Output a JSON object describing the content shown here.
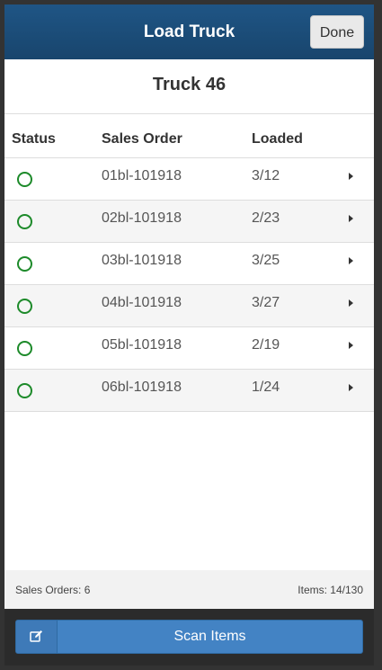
{
  "header": {
    "title": "Load Truck",
    "done_label": "Done"
  },
  "truck": {
    "title": "Truck 46"
  },
  "table": {
    "columns": [
      "Status",
      "Sales Order",
      "Loaded"
    ],
    "rows": [
      {
        "status": "incomplete",
        "order": "01bl-101918",
        "loaded": "3/12"
      },
      {
        "status": "incomplete",
        "order": "02bl-101918",
        "loaded": "2/23"
      },
      {
        "status": "incomplete",
        "order": "03bl-101918",
        "loaded": "3/25"
      },
      {
        "status": "incomplete",
        "order": "04bl-101918",
        "loaded": "3/27"
      },
      {
        "status": "incomplete",
        "order": "05bl-101918",
        "loaded": "2/19"
      },
      {
        "status": "incomplete",
        "order": "06bl-101918",
        "loaded": "1/24"
      }
    ]
  },
  "summary": {
    "sales_orders": "Sales Orders: 6",
    "items": "Items: 14/130"
  },
  "footer": {
    "edit_icon": "edit-icon",
    "scan_label": "Scan Items"
  },
  "colors": {
    "header_bg": "#1f5585",
    "status_green": "#1d8a2a",
    "button_blue": "#4383c4"
  }
}
